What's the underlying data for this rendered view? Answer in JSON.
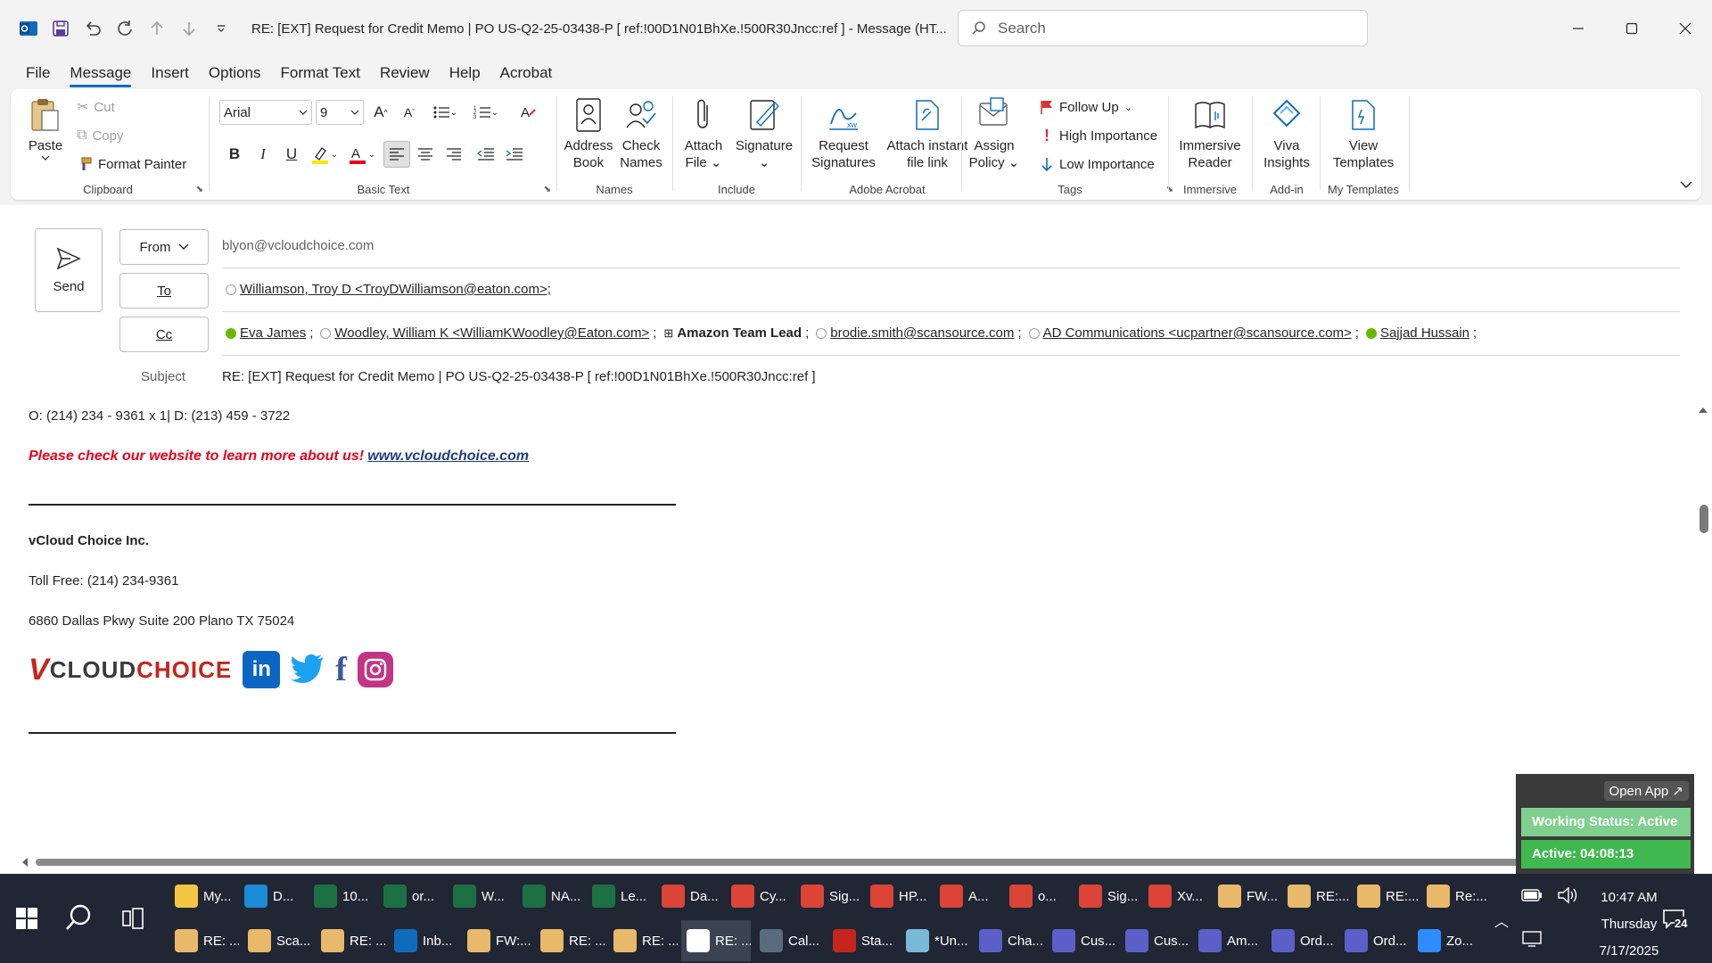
{
  "window": {
    "title": "RE: [EXT] Request for Credit Memo | PO US-Q2-25-03438-P     [ ref:!00D1N01BhXe.!500R30Jncc:ref ]  -  Message (HT...",
    "search_placeholder": "Search"
  },
  "menu": {
    "tabs": [
      "File",
      "Message",
      "Insert",
      "Options",
      "Format Text",
      "Review",
      "Help",
      "Acrobat"
    ],
    "active": "Message"
  },
  "ribbon": {
    "clipboard": {
      "paste": "Paste",
      "cut": "Cut",
      "copy": "Copy",
      "format_painter": "Format Painter",
      "label": "Clipboard"
    },
    "basic_text": {
      "font": "Arial",
      "size": "9",
      "label": "Basic Text"
    },
    "names": {
      "address_book_1": "Address",
      "address_book_2": "Book",
      "check_names_1": "Check",
      "check_names_2": "Names",
      "label": "Names"
    },
    "include": {
      "attach_1": "Attach",
      "attach_2": "File",
      "signature": "Signature",
      "label": "Include"
    },
    "adobe": {
      "request_1": "Request",
      "request_2": "Signatures",
      "attach_link_1": "Attach instant",
      "attach_link_2": "file link",
      "label": "Adobe Acrobat"
    },
    "tags": {
      "assign_1": "Assign",
      "assign_2": "Policy",
      "follow_up": "Follow Up",
      "high": "High Importance",
      "low": "Low Importance",
      "label": "Tags"
    },
    "immersive": {
      "reader_1": "Immersive",
      "reader_2": "Reader",
      "label": "Immersive"
    },
    "addin": {
      "viva_1": "Viva",
      "viva_2": "Insights",
      "label": "Add-in"
    },
    "templates": {
      "view_1": "View",
      "view_2": "Templates",
      "label": "My Templates"
    }
  },
  "compose": {
    "send": "Send",
    "from_label": "From",
    "from_value": "blyon@vcloudchoice.com",
    "to_label": "To",
    "to_recipients": [
      "Williamson, Troy D <TroyDWilliamson@eaton.com>;"
    ],
    "cc_label": "Cc",
    "cc_recipients": [
      {
        "name": "Eva James",
        "presence": "available"
      },
      {
        "name": "Woodley, William K <WilliamKWoodley@Eaton.com>",
        "presence": "offline"
      },
      {
        "name": "Amazon Team Lead",
        "presence": "group"
      },
      {
        "name": "brodie.smith@scansource.com",
        "presence": "offline"
      },
      {
        "name": "AD Communications <ucpartner@scansource.com>",
        "presence": "offline"
      },
      {
        "name": "Sajjad Hussain",
        "presence": "available"
      }
    ],
    "subject_label": "Subject",
    "subject_value": "RE: [EXT] Request for Credit Memo | PO US-Q2-25-03438-P     [ ref:!00D1N01BhXe.!500R30Jncc:ref ]"
  },
  "body": {
    "phone_line": "O: (214) 234 - 9361 x 1| D: (213) 459 - 3722",
    "promo": "Please check our website to learn more about us!",
    "website": "www.vcloudchoice.com",
    "company": "vCloud Choice Inc.",
    "toll_free": "Toll Free: (214) 234-9361",
    "address": "6860 Dallas Pkwy Suite 200 Plano TX 75024",
    "logo_text": "VCLOUDCHOICE"
  },
  "widget": {
    "open_app": "Open App ↗",
    "status": "Working Status: Active",
    "active_timer": "Active: 04:08:13"
  },
  "taskbar": {
    "row1": [
      {
        "label": "My...",
        "icon": "folder-icon",
        "color": "#f4c542"
      },
      {
        "label": "D...",
        "icon": "edge-icon",
        "color": "#1b8bd8"
      },
      {
        "label": "10...",
        "icon": "excel-icon",
        "color": "#1d7044"
      },
      {
        "label": "or...",
        "icon": "excel-icon",
        "color": "#1d7044"
      },
      {
        "label": "W...",
        "icon": "excel-icon",
        "color": "#1d7044"
      },
      {
        "label": "NA...",
        "icon": "excel-icon",
        "color": "#1d7044"
      },
      {
        "label": "Le...",
        "icon": "excel-icon",
        "color": "#1d7044"
      },
      {
        "label": "Da...",
        "icon": "chrome-icon",
        "color": "#db4437"
      },
      {
        "label": "Cy...",
        "icon": "chrome-icon",
        "color": "#db4437"
      },
      {
        "label": "Sig...",
        "icon": "chrome-icon",
        "color": "#db4437"
      },
      {
        "label": "HP...",
        "icon": "chrome-icon",
        "color": "#db4437"
      },
      {
        "label": "A...",
        "icon": "chrome-icon",
        "color": "#db4437"
      },
      {
        "label": "o...",
        "icon": "chrome-icon",
        "color": "#db4437"
      },
      {
        "label": "Sig...",
        "icon": "chrome-icon",
        "color": "#db4437"
      },
      {
        "label": "Xv...",
        "icon": "chrome-icon",
        "color": "#db4437"
      },
      {
        "label": "FW...",
        "icon": "mail-icon",
        "color": "#e8b96a"
      },
      {
        "label": "RE:...",
        "icon": "mail-icon",
        "color": "#e8b96a"
      },
      {
        "label": "RE:...",
        "icon": "mail-icon",
        "color": "#e8b96a"
      },
      {
        "label": "Re:...",
        "icon": "mail-icon",
        "color": "#e8b96a"
      }
    ],
    "row2": [
      {
        "label": "RE: ...",
        "icon": "mail-icon",
        "color": "#e8b96a"
      },
      {
        "label": "Sca...",
        "icon": "mail-icon",
        "color": "#e8b96a"
      },
      {
        "label": "RE: ...",
        "icon": "mail-icon",
        "color": "#e8b96a"
      },
      {
        "label": "Inb...",
        "icon": "outlook-icon",
        "color": "#0f6cbd"
      },
      {
        "label": "FW:...",
        "icon": "mail-icon",
        "color": "#e8b96a"
      },
      {
        "label": "RE: ...",
        "icon": "mail-icon",
        "color": "#e8b96a"
      },
      {
        "label": "RE: ...",
        "icon": "mail-icon",
        "color": "#e8b96a"
      },
      {
        "label": "RE: ...",
        "icon": "mail-icon",
        "color": "#ffffff"
      },
      {
        "label": "Cal...",
        "icon": "calculator-icon",
        "color": "#5a6b7d"
      },
      {
        "label": "Sta...",
        "icon": "pdf-icon",
        "color": "#c4261d"
      },
      {
        "label": "*Un...",
        "icon": "notepad-icon",
        "color": "#7ab8d8"
      },
      {
        "label": "Cha...",
        "icon": "teams-icon",
        "color": "#5b5fc7"
      },
      {
        "label": "Cus...",
        "icon": "teams-icon",
        "color": "#5b5fc7"
      },
      {
        "label": "Cus...",
        "icon": "teams-icon",
        "color": "#5b5fc7"
      },
      {
        "label": "Am...",
        "icon": "teams-icon",
        "color": "#5b5fc7"
      },
      {
        "label": "Ord...",
        "icon": "teams-icon",
        "color": "#5b5fc7"
      },
      {
        "label": "Ord...",
        "icon": "teams-icon",
        "color": "#5b5fc7"
      },
      {
        "label": "Zo...",
        "icon": "zoom-icon",
        "color": "#2d8cff"
      }
    ],
    "time": "10:47 AM",
    "day": "Thursday",
    "date": "7/17/2025",
    "notification_count": "24"
  }
}
